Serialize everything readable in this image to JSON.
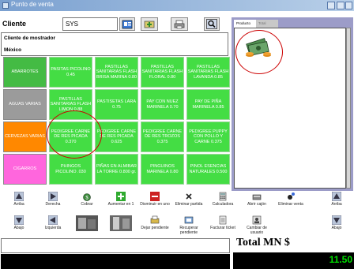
{
  "window": {
    "title": "Punto de venta"
  },
  "client": {
    "label": "Cliente",
    "value": "SYS"
  },
  "customer": {
    "label": "Cliente de mostrador",
    "value": "México"
  },
  "categories": [
    {
      "label": "ABARROTES",
      "color": "#44bb44"
    },
    {
      "label": "AGUAS VARIAS",
      "color": "#9b9b9b"
    },
    {
      "label": "CERVEZAS VARIAS",
      "color": "#ff8800"
    },
    {
      "label": "CIGARROS",
      "color": "#ff66dd"
    }
  ],
  "products": [
    [
      "PASITAS PICOLINO 0.45",
      "PASTILLAS SANITARIAS FLASH BRISA MARINA 0.80",
      "PASTILLAS SANITARIAS FLASH FLORAL 0.80",
      "PASTILLAS SANITARIAS FLASH LAVANDA 0.85"
    ],
    [
      "PASTILLAS SANITARIAS FLASH LIMON 0.88",
      "PASTISETAS LARA 0.75",
      "PAY CON NUEZ MARINELA 0.70",
      "PAY DE PIÑA MARINELA 0.85"
    ],
    [
      "PEDIGREE CARNE DE RES PICADA 0.370",
      "PEDIGREE CARNE DE RES PICADA 0.625",
      "PEDIGREE CARNE DE RES TROZOS 0.375",
      "PEDIGREE PUPPY CON POLLO Y CARNE 0.375"
    ],
    [
      "PHINGOS PICOLINO .030",
      "PIÑAS EN ALMIBAR LA TORRE 0.800 gr.",
      "PINGUINOS MARINELA 0.80",
      "PINOL ESENCIAS NATURALES 0.500"
    ]
  ],
  "panel": {
    "tabs": [
      "Producto",
      "Total"
    ]
  },
  "toolbar": {
    "row1": [
      "Arriba",
      "Derecha",
      "Cobrar",
      "Aumentar en 1",
      "Disminuir en uno",
      "Eliminar partida",
      "Calculadora",
      "Abrir cajón",
      "Eliminar venta",
      "Arriba"
    ],
    "row2": [
      "Abajo",
      "Izquierda",
      "",
      "",
      "Dejar pendiente",
      "Recuperar pendiente",
      "Facturar ticket",
      "Cambiar de usuario",
      "",
      "Abajo"
    ]
  },
  "total": {
    "label": "Total MN $",
    "value": "11.50"
  },
  "colors": {
    "product": "#44dd44",
    "panel": "#9c9cc8",
    "total_text": "#00e000",
    "annotation": "#cc0000"
  }
}
